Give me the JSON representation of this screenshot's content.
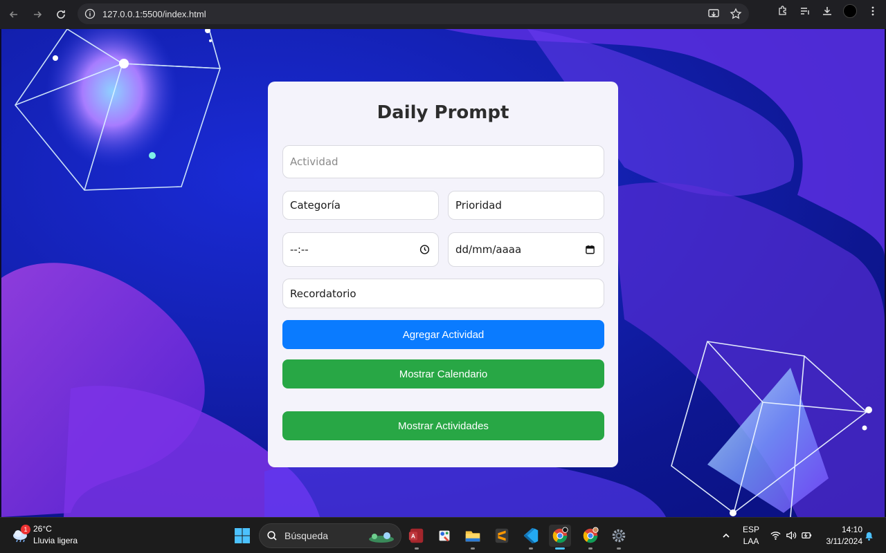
{
  "browser": {
    "url": "127.0.0.1:5500/index.html"
  },
  "app": {
    "title": "Daily Prompt",
    "fields": {
      "activity_placeholder": "Actividad",
      "category_value": "Categoría",
      "priority_value": "Prioridad",
      "time_value": "--:--",
      "date_value": "dd/mm/aaaa",
      "reminder_value": "Recordatorio"
    },
    "buttons": {
      "add": "Agregar Actividad",
      "calendar": "Mostrar Calendario",
      "activities": "Mostrar Actividades"
    },
    "colors": {
      "primary": "#0a7bff",
      "success": "#28a745"
    }
  },
  "taskbar": {
    "weather": {
      "temp": "26°C",
      "desc": "Lluvia ligera",
      "badge": "1"
    },
    "search_label": "Búsqueda",
    "lang_top": "ESP",
    "lang_bottom": "LAA",
    "time": "14:10",
    "date": "3/11/2024",
    "apps": [
      "access-icon",
      "paint-icon",
      "file-explorer-icon",
      "sublime-text-icon",
      "vscode-icon",
      "chrome-icon",
      "chrome-profile-icon",
      "settings-icon"
    ]
  }
}
